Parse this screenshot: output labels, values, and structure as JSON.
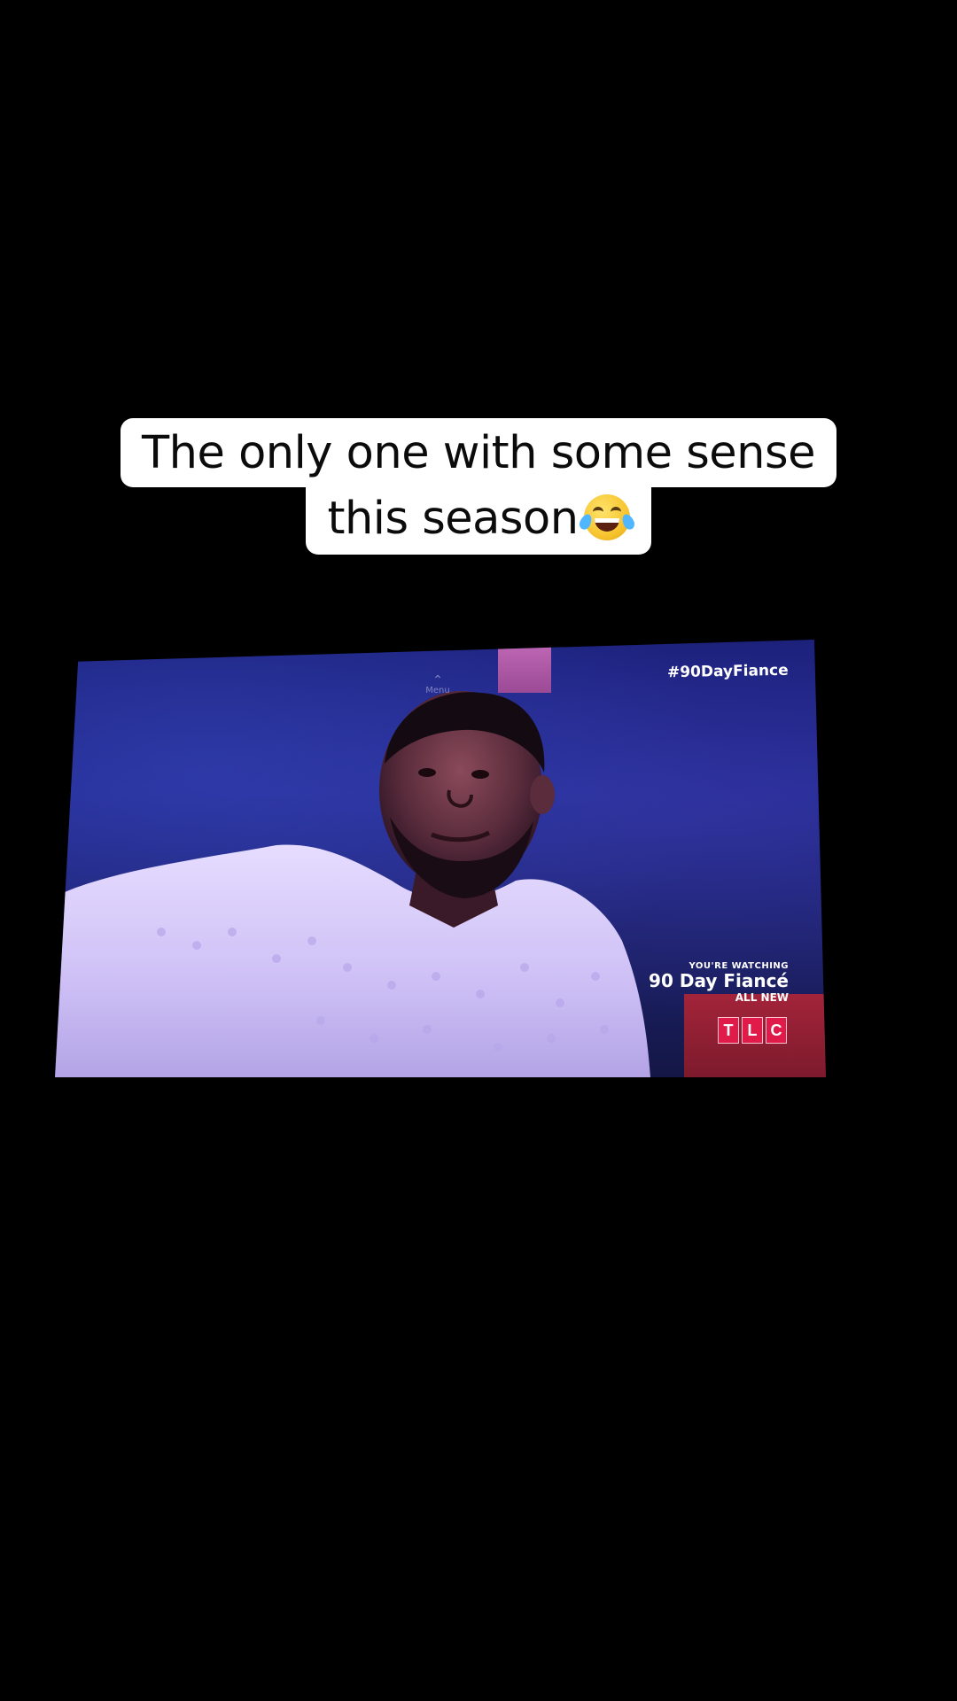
{
  "caption": {
    "line1": "The only one with some sense",
    "line2": "this season",
    "emoji": "face-with-tears-of-joy-icon"
  },
  "tv": {
    "menu_hint": "Menu",
    "hashtag": "#90DayFiance",
    "watching_label": "YOU'RE WATCHING",
    "show_title": "90 Day Fiancé",
    "badge_text": "ALL NEW",
    "network_letters": [
      "T",
      "L",
      "C"
    ]
  },
  "colors": {
    "background": "#000000",
    "caption_bg": "#ffffff",
    "caption_text": "#0b0b0b",
    "tlc_red": "#e01b4a",
    "screen_blue": "#23288f"
  }
}
